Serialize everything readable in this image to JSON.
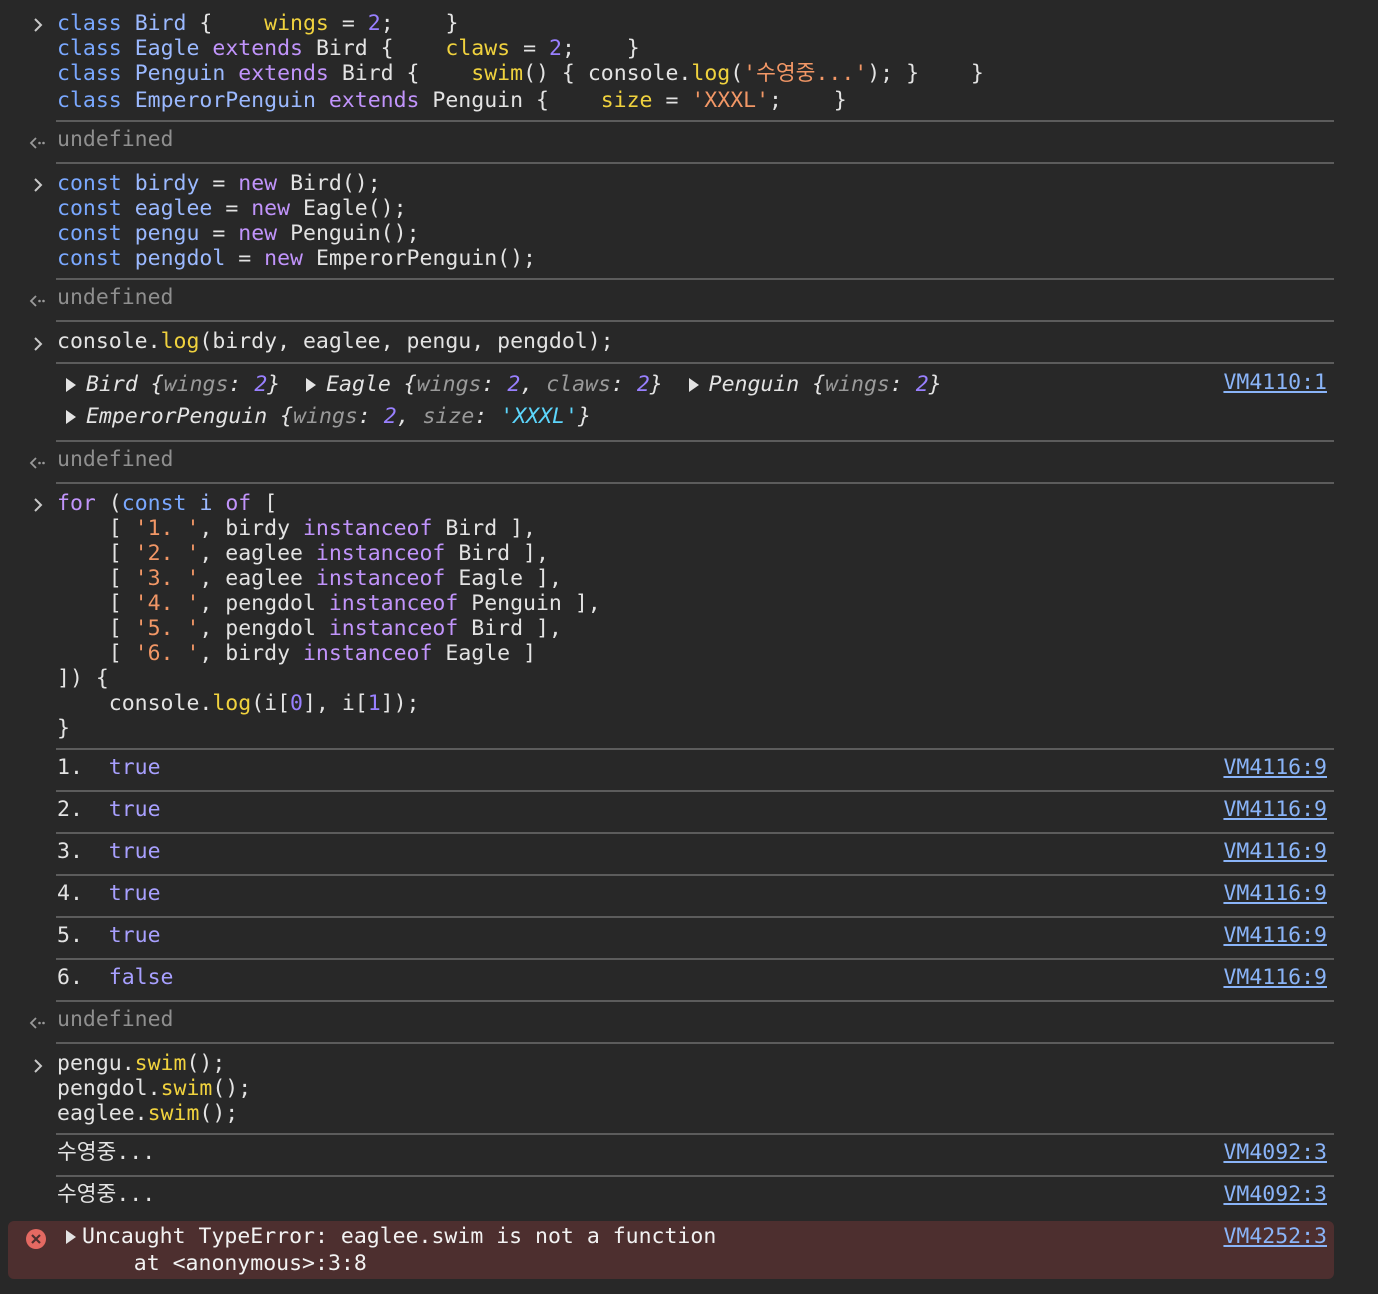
{
  "block1": {
    "l1": [
      "class",
      "Bird",
      "{",
      "wings",
      "=",
      "2",
      ";",
      "}"
    ],
    "l2": [
      "class",
      "Eagle",
      "extends",
      "Bird",
      "{",
      "claws",
      "=",
      "2",
      ";",
      "}"
    ],
    "l3": [
      "class",
      "Penguin",
      "extends",
      "Bird",
      "{",
      "swim",
      "()",
      "{",
      "console.",
      "log",
      "(",
      "'수영중...'",
      ");",
      "}",
      "}"
    ],
    "l4": [
      "class",
      "EmperorPenguin",
      "extends",
      "Penguin",
      "{",
      "size",
      "=",
      "'XXXL'",
      ";",
      "}"
    ]
  },
  "undefined_text": "undefined",
  "block2": {
    "l1": [
      "const",
      "birdy",
      "=",
      "new",
      "Bird();"
    ],
    "l2": [
      "const",
      "eaglee",
      "=",
      "new",
      "Eagle();"
    ],
    "l3": [
      "const",
      "pengu",
      "=",
      "new",
      "Penguin();"
    ],
    "l4": [
      "const",
      "pengdol",
      "=",
      "new",
      "EmperorPenguin();"
    ]
  },
  "block3": {
    "code_a": "console.",
    "code_fn": "log",
    "code_b": "(birdy, eaglee, pengu, pengdol);",
    "out": {
      "bird": "Bird",
      "eagle": "Eagle",
      "penguin": "Penguin",
      "emperor": "EmperorPenguin",
      "wings_key": "wings",
      "claws_key": "claws",
      "size_key": "size",
      "two": "2",
      "xxxl": "'XXXL'"
    },
    "link": "VM4110:1"
  },
  "block4": {
    "for": "for",
    "const": "const",
    "i": "i",
    "of": "of",
    "rows": [
      {
        "str": "'1. '",
        "var": "birdy",
        "op": "instanceof",
        "cls": "Bird",
        "end": " ],"
      },
      {
        "str": "'2. '",
        "var": "eaglee",
        "op": "instanceof",
        "cls": "Bird",
        "end": " ],"
      },
      {
        "str": "'3. '",
        "var": "eaglee",
        "op": "instanceof",
        "cls": "Eagle",
        "end": " ],"
      },
      {
        "str": "'4. '",
        "var": "pengdol",
        "op": "instanceof",
        "cls": "Penguin",
        "end": " ],"
      },
      {
        "str": "'5. '",
        "var": "pengdol",
        "op": "instanceof",
        "cls": "Bird",
        "end": " ],"
      },
      {
        "str": "'6. '",
        "var": "birdy",
        "op": "instanceof",
        "cls": "Eagle",
        "end": " ]"
      }
    ],
    "close": "]) {",
    "body_a": "console.",
    "body_fn": "log",
    "body_b": "(i[",
    "zero": "0",
    "body_c": "], i[",
    "one": "1",
    "body_d": "]);",
    "brace": "}"
  },
  "results": [
    {
      "n": "1.",
      "v": "true",
      "link": "VM4116:9"
    },
    {
      "n": "2.",
      "v": "true",
      "link": "VM4116:9"
    },
    {
      "n": "3.",
      "v": "true",
      "link": "VM4116:9"
    },
    {
      "n": "4.",
      "v": "true",
      "link": "VM4116:9"
    },
    {
      "n": "5.",
      "v": "true",
      "link": "VM4116:9"
    },
    {
      "n": "6.",
      "v": "false",
      "link": "VM4116:9"
    }
  ],
  "block5": {
    "l1a": "pengu.",
    "l2a": "pengdol.",
    "l3a": "eaglee.",
    "fn": "swim",
    "end": "();"
  },
  "swim_logs": [
    {
      "text": "수영중...",
      "link": "VM4092:3"
    },
    {
      "text": "수영중...",
      "link": "VM4092:3"
    }
  ],
  "error": {
    "line1": "Uncaught TypeError: eaglee.swim is not a function",
    "line2": "    at <anonymous>:3:8",
    "link": "VM4252:3"
  }
}
